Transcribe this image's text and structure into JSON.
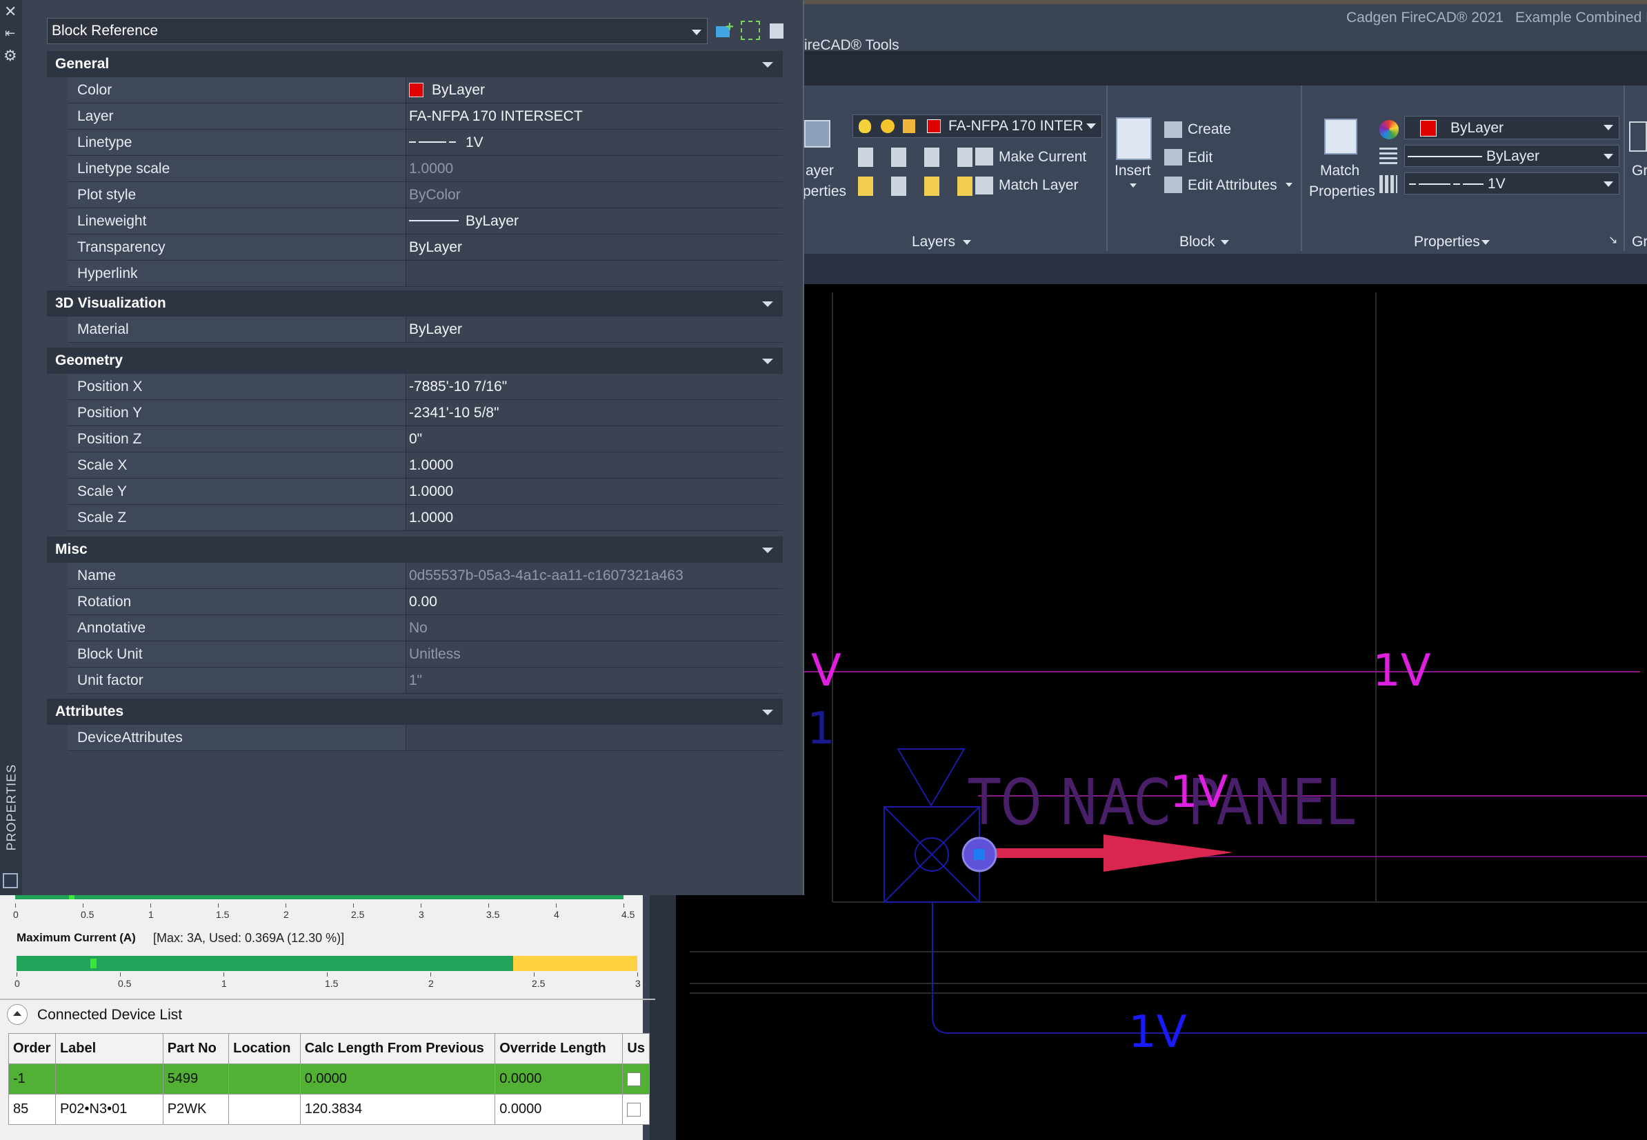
{
  "app": {
    "title": "Cadgen FireCAD® 2021",
    "document": "Example Combined F",
    "tab": "ireCAD® Tools"
  },
  "ribbon": {
    "layer_props_label_1": "ayer",
    "layer_props_label_2": "perties",
    "layer_dropdown": "FA-NFPA 170 INTER",
    "make_current": "Make Current",
    "match_layer": "Match Layer",
    "layers_group": "Layers",
    "insert": "Insert",
    "create": "Create",
    "edit": "Edit",
    "edit_attributes": "Edit Attributes",
    "block_group": "Block",
    "match_properties_1": "Match",
    "match_properties_2": "Properties",
    "color_value": "ByLayer",
    "lineweight_value": "ByLayer",
    "linetype_value": "1V",
    "properties_group": "Properties",
    "next_group": "Gr"
  },
  "palette": {
    "selector": "Block Reference",
    "vertical_title": "PROPERTIES",
    "sections": {
      "general": "General",
      "visualization": "3D Visualization",
      "geometry": "Geometry",
      "misc": "Misc",
      "attributes": "Attributes"
    },
    "general": [
      {
        "key": "Color",
        "value": "ByLayer"
      },
      {
        "key": "Layer",
        "value": "FA-NFPA 170 INTERSECT"
      },
      {
        "key": "Linetype",
        "value": "1V"
      },
      {
        "key": "Linetype scale",
        "value": "1.0000"
      },
      {
        "key": "Plot style",
        "value": "ByColor"
      },
      {
        "key": "Lineweight",
        "value": "ByLayer"
      },
      {
        "key": "Transparency",
        "value": "ByLayer"
      },
      {
        "key": "Hyperlink",
        "value": ""
      }
    ],
    "visualization": [
      {
        "key": "Material",
        "value": "ByLayer"
      }
    ],
    "geometry": [
      {
        "key": "Position X",
        "value": "-7885'-10 7/16\""
      },
      {
        "key": "Position Y",
        "value": "-2341'-10 5/8\""
      },
      {
        "key": "Position Z",
        "value": "0\""
      },
      {
        "key": "Scale X",
        "value": "1.0000"
      },
      {
        "key": "Scale Y",
        "value": "1.0000"
      },
      {
        "key": "Scale Z",
        "value": "1.0000"
      }
    ],
    "misc": [
      {
        "key": "Name",
        "value": "0d55537b-05a3-4a1c-aa11-c1607321a463"
      },
      {
        "key": "Rotation",
        "value": "0.00"
      },
      {
        "key": "Annotative",
        "value": "No"
      },
      {
        "key": "Block Unit",
        "value": "Unitless"
      },
      {
        "key": "Unit factor",
        "value": "1\""
      }
    ],
    "attributes": [
      {
        "key": "DeviceAttributes",
        "value": ""
      }
    ]
  },
  "drawing": {
    "label_v_left": "V",
    "label_1v_top": "1V",
    "label_1_left": "1",
    "label_nac": "TO NAC PANEL",
    "label_1v_mid": "1V",
    "label_1v_bottom": "1V"
  },
  "device_panel": {
    "gauge1_ticks": [
      "0",
      "0.5",
      "1",
      "1.5",
      "2",
      "2.5",
      "3",
      "3.5",
      "4",
      "4.5"
    ],
    "current_title": "Maximum Current (A)",
    "current_info": "[Max: 3A, Used: 0.369A (12.30 %)]",
    "current_used_fraction": 0.123,
    "current_warning_start": 2.4,
    "current_max": 3,
    "gauge2_ticks": [
      "0",
      "0.5",
      "1",
      "1.5",
      "2",
      "2.5",
      "3"
    ],
    "list_title": "Connected Device List",
    "columns": [
      "Order",
      "Label",
      "Part No",
      "Location",
      "Calc Length From Previous",
      "Override Length",
      "Us"
    ],
    "rows": [
      {
        "order": "-1",
        "label": "",
        "part": "5499",
        "location": "",
        "calc": "0.0000",
        "override": "0.0000"
      },
      {
        "order": "85",
        "label": "P02•N3•01",
        "part": "P2WK",
        "location": "",
        "calc": "120.3834",
        "override": "0.0000"
      }
    ]
  },
  "colors": {
    "magenta_text": "#e020e0",
    "blue_text": "#1a1aff",
    "arrow": "#d8264f",
    "gauge_green": "#22a35a",
    "gauge_yellow": "#ffd040",
    "row_selected": "#52b034"
  }
}
